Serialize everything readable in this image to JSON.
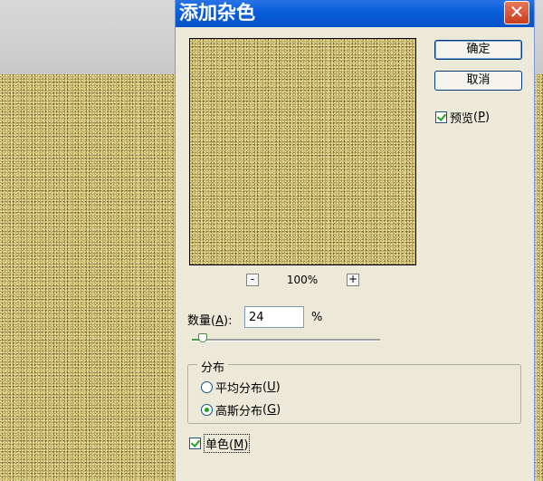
{
  "dialog": {
    "title": "添加杂色",
    "close_glyph": "✕"
  },
  "buttons": {
    "ok_label": "确定",
    "cancel_label": "取消"
  },
  "preview": {
    "label": "预览",
    "mnemonic": "P",
    "checked": true
  },
  "zoom": {
    "minus_label": "-",
    "plus_label": "+",
    "level": "100%"
  },
  "amount": {
    "label": "数量",
    "mnemonic": "A",
    "value": "24",
    "unit": "%",
    "slider_fraction": 0.06
  },
  "distribution": {
    "title": "分布",
    "options": [
      {
        "label": "平均分布",
        "mnemonic": "U",
        "selected": false
      },
      {
        "label": "高斯分布",
        "mnemonic": "G",
        "selected": true
      }
    ]
  },
  "monochromatic": {
    "label": "单色",
    "mnemonic": "M",
    "checked": true
  },
  "colors": {
    "title_bar": "#0a5fdc",
    "dialog_bg": "#ece9d8",
    "noise_base": "#b9a455",
    "close_red": "#c93c1c"
  }
}
